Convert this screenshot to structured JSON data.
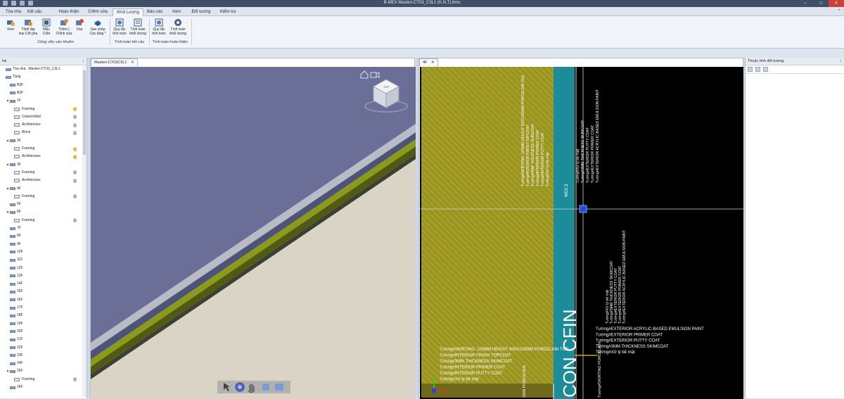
{
  "window": {
    "title": "B-MEX Masteri-CT03_C3L1 (K,N,T).bmx",
    "controls": {
      "minimize": "–",
      "maximize": "□",
      "close": "✕"
    }
  },
  "menu": {
    "tabs": [
      "Tòa nhà",
      "Kết cấu",
      "Hoàn thiện",
      "Chỉnh sửa",
      "Khối Lượng",
      "Báo cáo",
      "Xem",
      "Đối tượng",
      "Kiểm tra"
    ],
    "active": "Khối Lượng",
    "right_icon": "⌃"
  },
  "ribbon": {
    "buttons": [
      {
        "label": "Xem",
        "icon": "view-icon"
      },
      {
        "label": "Thiết lập loại Cốt pha",
        "icon": "formwork-setup-icon"
      },
      {
        "label": "Mẫu Cốfa",
        "icon": "template-icon"
      },
      {
        "label": "Thêm / Chỉnh sửa",
        "icon": "add-edit-icon"
      },
      {
        "label": "Xóa",
        "icon": "delete-icon"
      },
      {
        "label": "Sao chép Các tầng *",
        "icon": "copy-floors-icon"
      },
      {
        "label": "Quy tắc tính toán",
        "icon": "calc-rule-icon"
      },
      {
        "label": "Tính toán khối lượng",
        "icon": "calc-volume-icon"
      },
      {
        "label": "Quy tắc tính toán",
        "icon": "calc-rule-icon"
      },
      {
        "label": "Tính toán khối lượng",
        "icon": "gear-icon"
      }
    ],
    "groups": [
      "Công việc ván khuôn",
      "Tính toán kết cấu",
      "Tính toán hoàn thiện"
    ]
  },
  "left_panel": {
    "header": "hà",
    "pin": "↓",
    "tree": [
      {
        "label": "Tòa nhà : Masteri-CT03_C3L1",
        "level": 0,
        "toggle": "",
        "icon": "building",
        "lamp": ""
      },
      {
        "label": "Tầng",
        "level": 0,
        "toggle": "",
        "icon": "floor",
        "lamp": ""
      },
      {
        "label": "B3F",
        "level": 1,
        "toggle": "",
        "icon": "floor",
        "lamp": ""
      },
      {
        "label": "B2F",
        "level": 1,
        "toggle": "",
        "icon": "floor",
        "lamp": ""
      },
      {
        "label": "1F",
        "level": 1,
        "toggle": "▲",
        "icon": "floor",
        "lamp": ""
      },
      {
        "label": "Framing",
        "level": 2,
        "toggle": "",
        "icon": "layer",
        "lamp": "on"
      },
      {
        "label": "ColumnWall",
        "level": 2,
        "toggle": "",
        "icon": "layer",
        "lamp": "off"
      },
      {
        "label": "Architecture",
        "level": 2,
        "toggle": "",
        "icon": "layer",
        "lamp": "off"
      },
      {
        "label": "Block",
        "level": 2,
        "toggle": "",
        "icon": "layer",
        "lamp": "off"
      },
      {
        "label": "2F",
        "level": 1,
        "toggle": "▲",
        "icon": "floor",
        "lamp": ""
      },
      {
        "label": "Framing",
        "level": 2,
        "toggle": "",
        "icon": "layer",
        "lamp": "on"
      },
      {
        "label": "Architecture",
        "level": 2,
        "toggle": "",
        "icon": "layer",
        "lamp": "on"
      },
      {
        "label": "3F",
        "level": 1,
        "toggle": "▲",
        "icon": "floor",
        "lamp": ""
      },
      {
        "label": "Framing",
        "level": 2,
        "toggle": "",
        "icon": "layer",
        "lamp": "off"
      },
      {
        "label": "Architecture",
        "level": 2,
        "toggle": "",
        "icon": "layer",
        "lamp": "off"
      },
      {
        "label": "4F",
        "level": 1,
        "toggle": "▲",
        "icon": "floor",
        "lamp": ""
      },
      {
        "label": "Framing",
        "level": 2,
        "toggle": "",
        "icon": "layer",
        "lamp": "off"
      },
      {
        "label": "5F",
        "level": 1,
        "toggle": "",
        "icon": "floor",
        "lamp": ""
      },
      {
        "label": "6F",
        "level": 1,
        "toggle": "▲",
        "icon": "floor",
        "lamp": ""
      },
      {
        "label": "Framing",
        "level": 2,
        "toggle": "",
        "icon": "layer",
        "lamp": "off"
      },
      {
        "label": "7F",
        "level": 1,
        "toggle": "",
        "icon": "floor",
        "lamp": ""
      },
      {
        "label": "8F",
        "level": 1,
        "toggle": "",
        "icon": "floor",
        "lamp": ""
      },
      {
        "label": "9F",
        "level": 1,
        "toggle": "",
        "icon": "floor",
        "lamp": ""
      },
      {
        "label": "10F",
        "level": 1,
        "toggle": "",
        "icon": "floor",
        "lamp": ""
      },
      {
        "label": "11F",
        "level": 1,
        "toggle": "",
        "icon": "floor",
        "lamp": ""
      },
      {
        "label": "12F",
        "level": 1,
        "toggle": "",
        "icon": "floor",
        "lamp": ""
      },
      {
        "label": "13F",
        "level": 1,
        "toggle": "",
        "icon": "floor",
        "lamp": ""
      },
      {
        "label": "14F",
        "level": 1,
        "toggle": "",
        "icon": "floor",
        "lamp": ""
      },
      {
        "label": "15F",
        "level": 1,
        "toggle": "",
        "icon": "floor",
        "lamp": ""
      },
      {
        "label": "16F",
        "level": 1,
        "toggle": "",
        "icon": "floor",
        "lamp": ""
      },
      {
        "label": "17F",
        "level": 1,
        "toggle": "",
        "icon": "floor",
        "lamp": ""
      },
      {
        "label": "18F",
        "level": 1,
        "toggle": "",
        "icon": "floor",
        "lamp": ""
      },
      {
        "label": "19F",
        "level": 1,
        "toggle": "",
        "icon": "floor",
        "lamp": ""
      },
      {
        "label": "20F",
        "level": 1,
        "toggle": "",
        "icon": "floor",
        "lamp": ""
      },
      {
        "label": "21F",
        "level": 1,
        "toggle": "",
        "icon": "floor",
        "lamp": ""
      },
      {
        "label": "22F",
        "level": 1,
        "toggle": "",
        "icon": "floor",
        "lamp": ""
      },
      {
        "label": "23F",
        "level": 1,
        "toggle": "",
        "icon": "floor",
        "lamp": ""
      },
      {
        "label": "24F",
        "level": 1,
        "toggle": "",
        "icon": "floor",
        "lamp": ""
      },
      {
        "label": "25F",
        "level": 1,
        "toggle": "▲",
        "icon": "floor",
        "lamp": ""
      },
      {
        "label": "Framing",
        "level": 2,
        "toggle": "",
        "icon": "layer",
        "lamp": "off"
      },
      {
        "label": "26F",
        "level": 1,
        "toggle": "",
        "icon": "floor",
        "lamp": ""
      }
    ]
  },
  "view3d": {
    "tab": "Masteri-CT03C3L1",
    "tab_close": "✕",
    "cube_label": "TOP",
    "toolbar_icons": [
      "select-arrow-icon",
      "orbit-icon",
      "pan-hand-icon",
      "zoom-icon",
      "fit-icon"
    ]
  },
  "cad_view": {
    "tab": "4F",
    "tab_close": "✕",
    "labels_top_left": [
      "Tường#SKIRTING: 100MM HEIGHT 600X100MM PORCELAIN TILE",
      "Tường#INTERIOR FINISH TOPCOAT",
      "Tường#3MM THICKNESS SKIMCOAT",
      "Tường#INTERIOR PRIMER COAT",
      "Tường#INTERIOR PUTTY COAT",
      "Tường#Xử lý bề mặt"
    ],
    "labels_top_right": [
      "Tường#Xử lý bề mặt",
      "Tường#3MM THICKNESS SKIMCOAT",
      "Tường#EXTERIOR PUTTY COAT",
      "Tường#EXTERIOR PRIMER COAT",
      "Tường#EXTERIOR ACRYLIC-BASED EMULSION PAINT"
    ],
    "labels_bottom_left": [
      "Tường#SKIRTING: 100MM HEIGHT 600X100MM PORCELAIN TILE",
      "Tường#INTERIOR FINISH TOPCOAT",
      "Tường#3MM THICKNESS SKIMCOAT",
      "Tường#INTERIOR PRIMER COAT",
      "Tường#INTERIOR PUTTY COAT",
      "Tường#Xử lý bề mặt"
    ],
    "labels_bottom_right": [
      "Tường#EXTERIOR ACRYLIC-BASED EMULSION PAINT",
      "Tường#EXTERIOR PRIMER COAT",
      "Tường#EXTERIOR PUTTY COAT",
      "Tường#3MM THICKNESS SKIMCOAT",
      "Tường#Xử lý bề mặt"
    ],
    "labels_vertical_lower": [
      "Tường#EXTERIOR ACRYLIC-BASED EMULSION PAINT",
      "Tường#EXTERIOR PRIMER COAT",
      "Tường#EXTERIOR PUTTY COAT",
      "Tường#3MM THICKNESS SKIMCOAT",
      "Tường#Xử lý bề mặt"
    ],
    "wall_tag": "WD2.3",
    "big_text": "CON CFIN",
    "bottom_vertical_left": "2MM PORCELAIN",
    "bottom_vertical_right": "Tường#SKIRTING PORCELAIN"
  },
  "right_panel": {
    "header": "Thuộc tính đối tượng",
    "pin": "↓"
  },
  "colors": {
    "title_bg": "#3e4f66",
    "ribbon_bg": "#f1f4f8",
    "view3d_top": "#6b6e96",
    "view3d_ground": "#d9d4c5",
    "wall_olive": "#505a12",
    "wall_yellow_green": "#8c9a1a",
    "cad_bg": "#000000",
    "cad_hatch": "#9a9420",
    "cad_teal": "#1c8c99"
  }
}
